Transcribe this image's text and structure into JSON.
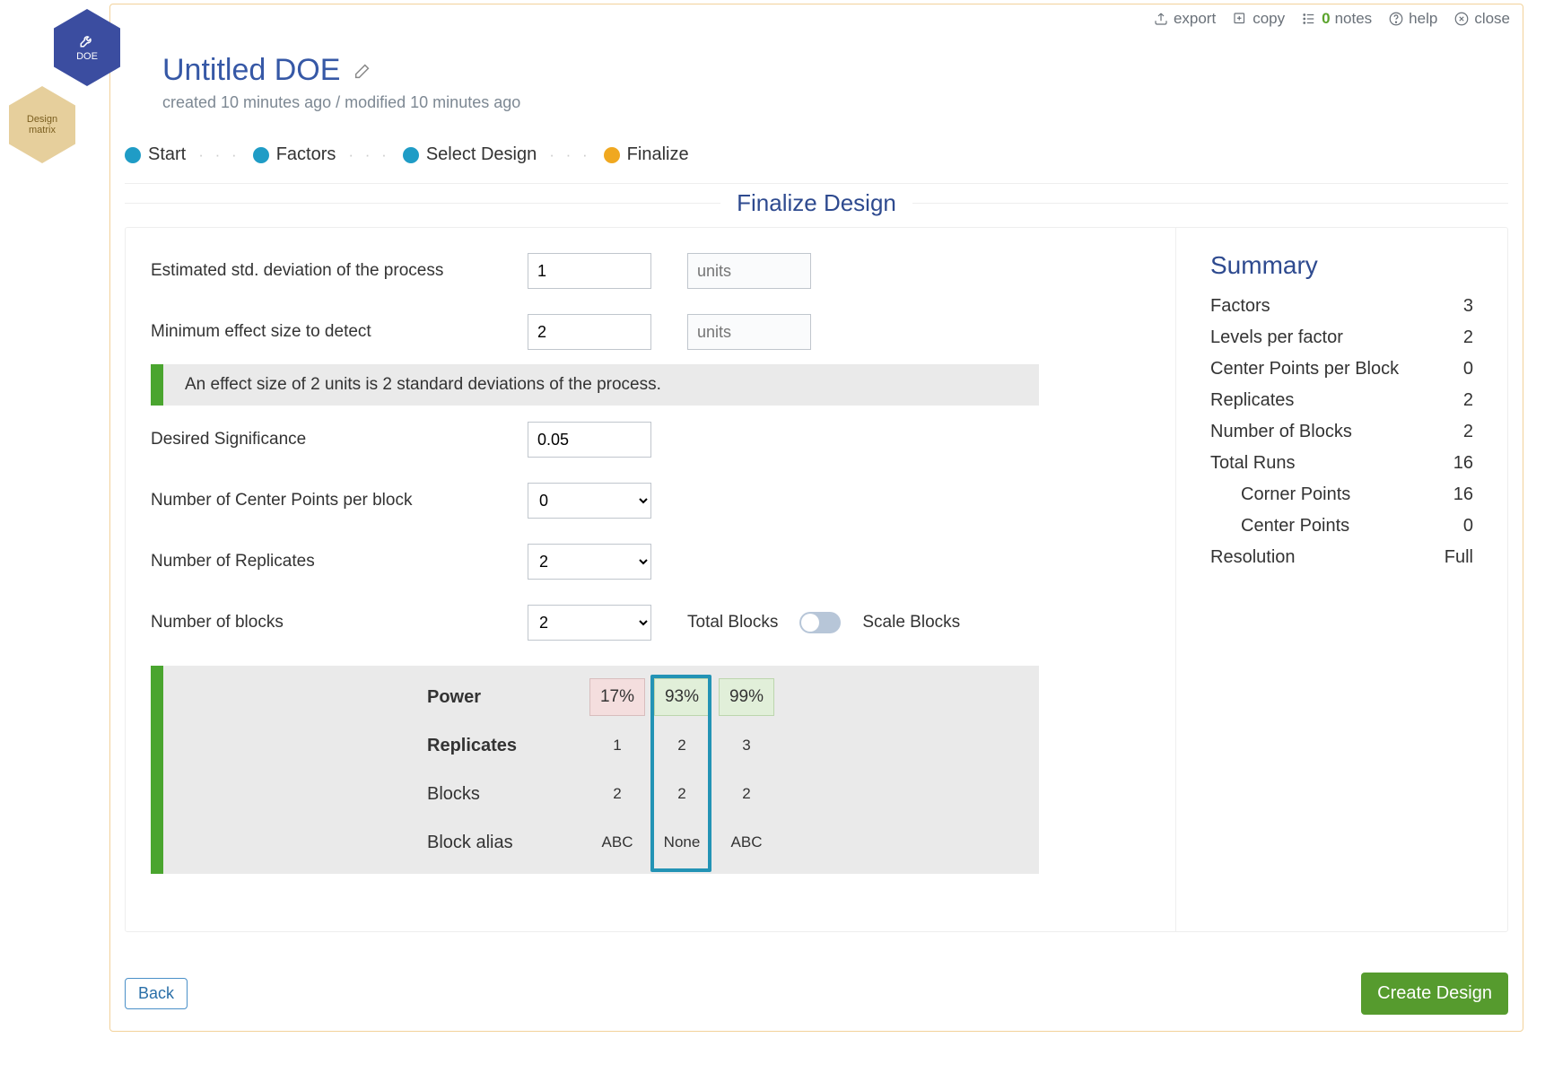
{
  "badges": {
    "doe": "DOE",
    "matrix_line1": "Design",
    "matrix_line2": "matrix"
  },
  "toolbar": {
    "export": "export",
    "copy": "copy",
    "notes_count": "0",
    "notes": "notes",
    "help": "help",
    "close": "close"
  },
  "header": {
    "title": "Untitled DOE",
    "subtitle": "created 10 minutes ago / modified 10 minutes ago"
  },
  "steps": [
    "Start",
    "Factors",
    "Select Design",
    "Finalize"
  ],
  "section_title": "Finalize Design",
  "form": {
    "std_dev_label": "Estimated std. deviation of the process",
    "std_dev_value": "1",
    "units_ph": "units",
    "min_effect_label": "Minimum effect size to detect",
    "min_effect_value": "2",
    "info": "An effect size of 2 units is 2 standard deviations of the process.",
    "sig_label": "Desired Significance",
    "sig_value": "0.05",
    "cp_label": "Number of Center Points per block",
    "cp_value": "0",
    "rep_label": "Number of Replicates",
    "rep_value": "2",
    "blocks_label": "Number of blocks",
    "blocks_value": "2",
    "total_blocks_label": "Total Blocks",
    "scale_blocks_label": "Scale Blocks"
  },
  "power_table": {
    "rows": [
      "Power",
      "Replicates",
      "Blocks",
      "Block alias"
    ],
    "cols": [
      {
        "power": "17%",
        "reps": "1",
        "blocks": "2",
        "alias": "ABC",
        "color": "red"
      },
      {
        "power": "93%",
        "reps": "2",
        "blocks": "2",
        "alias": "None",
        "color": "green",
        "selected": true
      },
      {
        "power": "99%",
        "reps": "3",
        "blocks": "2",
        "alias": "ABC",
        "color": "green"
      }
    ]
  },
  "summary": {
    "title": "Summary",
    "items": [
      {
        "label": "Factors",
        "value": "3"
      },
      {
        "label": "Levels per factor",
        "value": "2"
      },
      {
        "label": "Center Points per Block",
        "value": "0"
      },
      {
        "label": "Replicates",
        "value": "2"
      },
      {
        "label": "Number of Blocks",
        "value": "2"
      },
      {
        "label": "Total Runs",
        "value": "16"
      },
      {
        "label": "Corner Points",
        "value": "16",
        "indent": true
      },
      {
        "label": "Center Points",
        "value": "0",
        "indent": true
      },
      {
        "label": "Resolution",
        "value": "Full"
      }
    ]
  },
  "footer": {
    "back": "Back",
    "create": "Create Design"
  }
}
